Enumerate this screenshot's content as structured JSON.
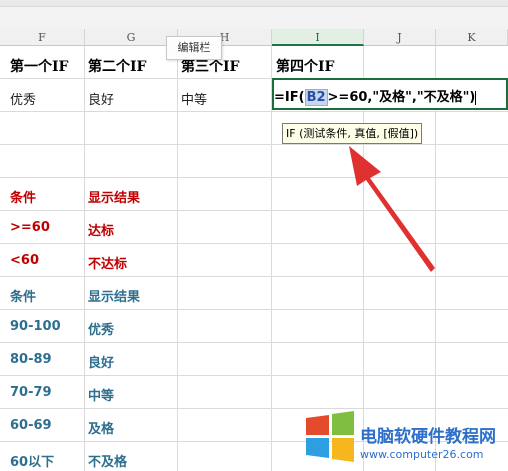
{
  "columns": [
    "F",
    "G",
    "H",
    "I",
    "J",
    "K"
  ],
  "active_column": "I",
  "tooltip_editbar": "编辑栏",
  "rows": {
    "headers": [
      "第一个IF",
      "第二个IF",
      "第三个IF",
      "第四个IF"
    ],
    "values": [
      "优秀",
      "良好",
      "中等"
    ],
    "formula": {
      "prefix": "=IF(",
      "ref": "B2",
      "suffix": ">=60,\"及格\",\"不及格\")"
    },
    "fn_tooltip": "IF (测试条件, 真值, [假值])",
    "table1_header": [
      "条件",
      "显示结果"
    ],
    "table1_rows": [
      [
        ">=60",
        "达标"
      ],
      [
        "<60",
        "不达标"
      ]
    ],
    "table2_header": [
      "条件",
      "显示结果"
    ],
    "table2_rows": [
      [
        "90-100",
        "优秀"
      ],
      [
        "80-89",
        "良好"
      ],
      [
        "70-79",
        "中等"
      ],
      [
        "60-69",
        "及格"
      ],
      [
        "60以下",
        "不及格"
      ]
    ]
  },
  "watermark": {
    "line1": "电脑软硬件教程网",
    "line2": "www.computer26.com"
  },
  "colors": {
    "red": "#c00000",
    "blue": "#2e6e8e",
    "active": "#217346",
    "arrow": "#e03030"
  }
}
